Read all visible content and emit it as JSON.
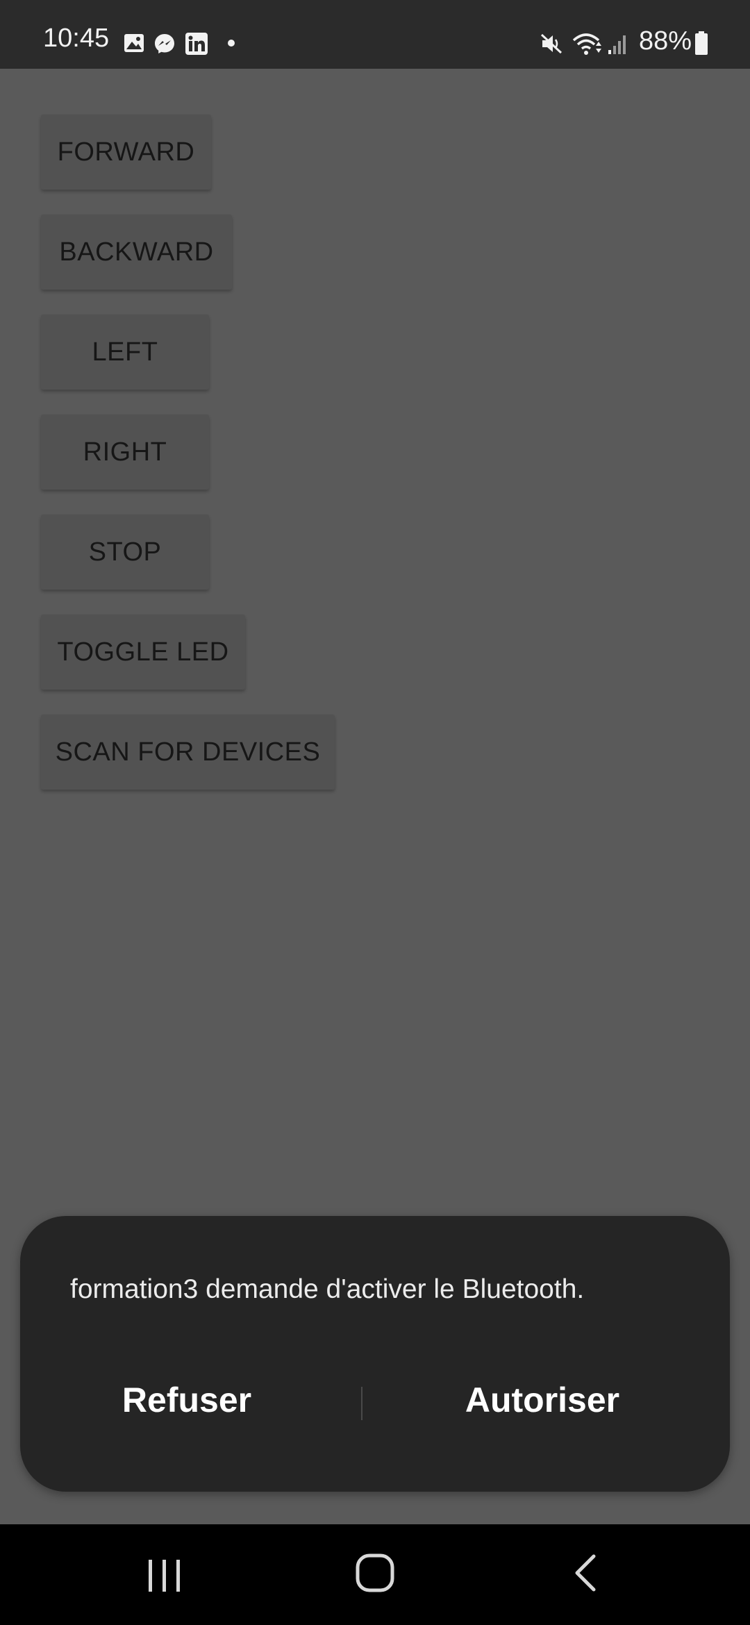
{
  "status_bar": {
    "time": "10:45",
    "notification_icons": [
      "gallery-icon",
      "messenger-icon",
      "linkedin-icon",
      "dot-icon"
    ],
    "system_icons": [
      "mute-icon",
      "wifi-icon",
      "signal-icon",
      "battery-icon"
    ],
    "battery": "88%"
  },
  "app": {
    "buttons": [
      {
        "label": "FORWARD"
      },
      {
        "label": "BACKWARD"
      },
      {
        "label": "LEFT"
      },
      {
        "label": "RIGHT"
      },
      {
        "label": "STOP"
      },
      {
        "label": "TOGGLE LED"
      },
      {
        "label": "SCAN FOR DEVICES"
      }
    ]
  },
  "dialog": {
    "message": "formation3 demande d'activer le Bluetooth.",
    "deny_label": "Refuser",
    "allow_label": "Autoriser"
  },
  "navigation": {
    "items": [
      "recent-apps-icon",
      "home-icon",
      "back-icon"
    ]
  },
  "colors": {
    "status_bar": "#2b2b2b",
    "scrim_background": "#5a5a5a",
    "dialog_background": "#252525",
    "nav_bar": "#000000"
  }
}
